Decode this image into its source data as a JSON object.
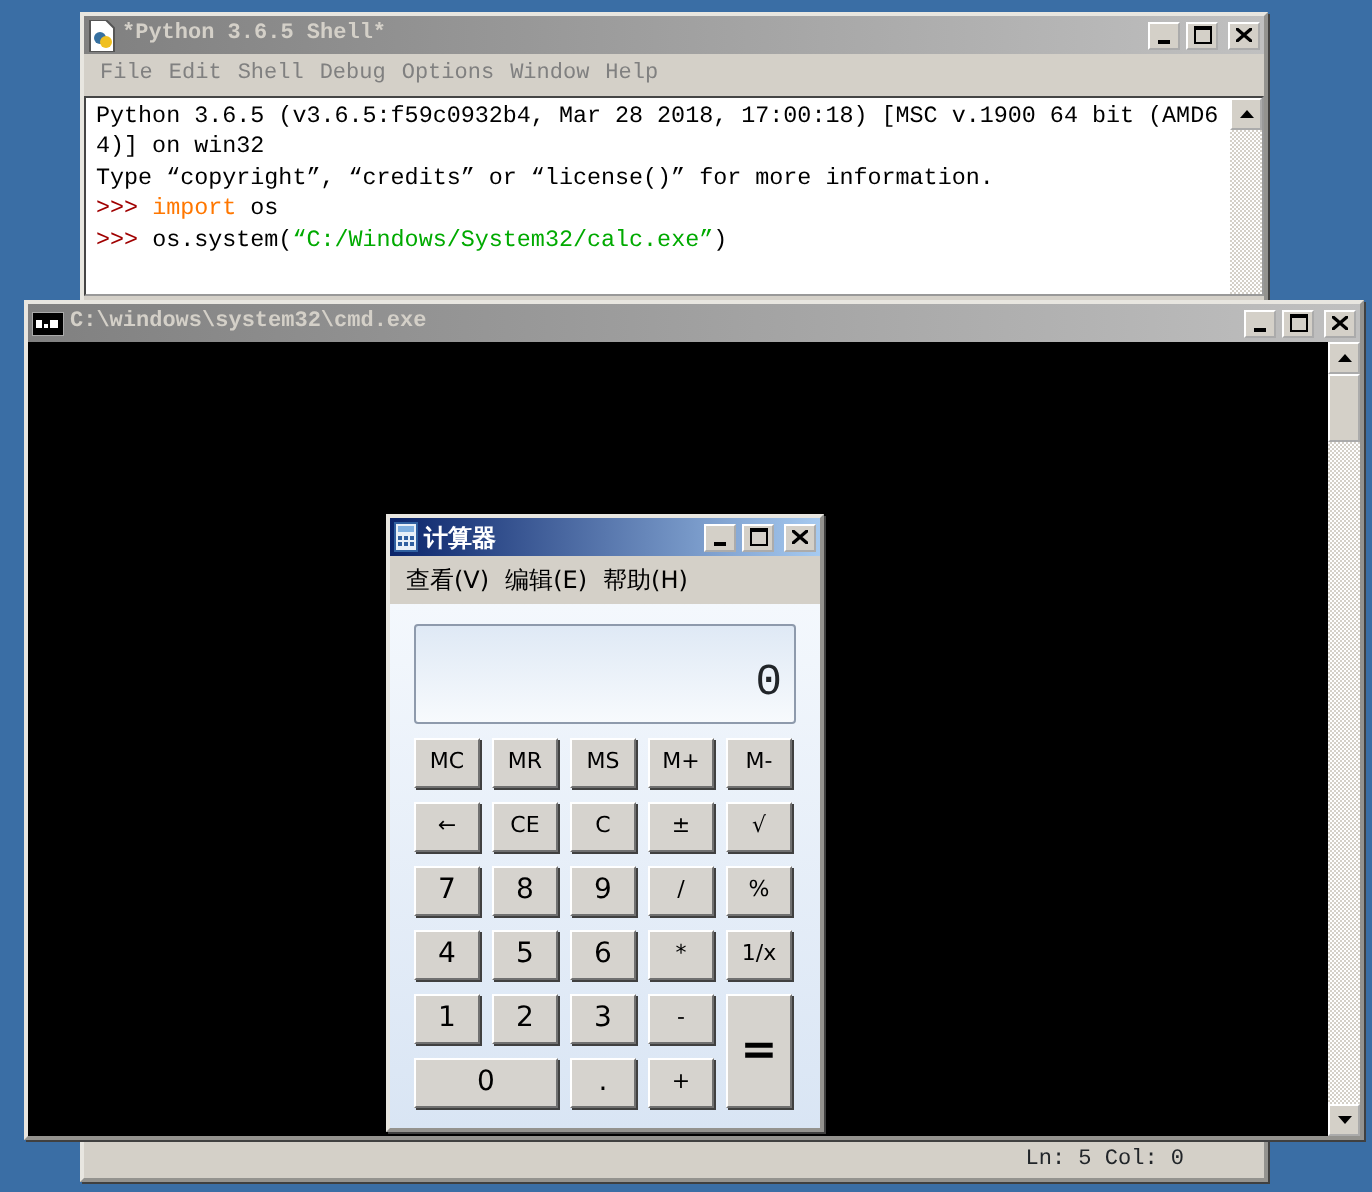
{
  "idle": {
    "title": "*Python 3.6.5 Shell*",
    "menu": [
      "File",
      "Edit",
      "Shell",
      "Debug",
      "Options",
      "Window",
      "Help"
    ],
    "lines": [
      [
        {
          "kind": "text",
          "text": "Python 3.6.5 (v3.6.5:f59c0932b4, Mar 28 2018, 17:00:18) [MSC v.1900 64 bit (AMD6"
        }
      ],
      [
        {
          "kind": "text",
          "text": "4)] on win32"
        }
      ],
      [
        {
          "kind": "text",
          "text": "Type “copyright”, “credits” or “license()” for more information."
        }
      ],
      [
        {
          "kind": "prompt",
          "text": ">>> "
        },
        {
          "kind": "keyword",
          "text": "import"
        },
        {
          "kind": "text",
          "text": " os"
        }
      ],
      [
        {
          "kind": "prompt",
          "text": ">>> "
        },
        {
          "kind": "text",
          "text": "os.system("
        },
        {
          "kind": "string",
          "text": "“C:/Windows/System32/calc.exe”"
        },
        {
          "kind": "text",
          "text": ")"
        }
      ]
    ],
    "status": "Ln: 5  Col: 0"
  },
  "cmd": {
    "title": "C:\\windows\\system32\\cmd.exe"
  },
  "calc": {
    "title": "计算器",
    "menu": [
      "查看(V)",
      "编辑(E)",
      "帮助(H)"
    ],
    "display": "0",
    "buttons": [
      {
        "label": "MC",
        "kind": "normal"
      },
      {
        "label": "MR",
        "kind": "normal"
      },
      {
        "label": "MS",
        "kind": "normal"
      },
      {
        "label": "M+",
        "kind": "normal"
      },
      {
        "label": "M-",
        "kind": "normal"
      },
      {
        "label": "←",
        "kind": "normal"
      },
      {
        "label": "CE",
        "kind": "normal"
      },
      {
        "label": "C",
        "kind": "normal"
      },
      {
        "label": "±",
        "kind": "normal"
      },
      {
        "label": "√",
        "kind": "normal"
      },
      {
        "label": "7",
        "kind": "normal"
      },
      {
        "label": "8",
        "kind": "normal"
      },
      {
        "label": "9",
        "kind": "normal"
      },
      {
        "label": "/",
        "kind": "normal"
      },
      {
        "label": "%",
        "kind": "normal"
      },
      {
        "label": "4",
        "kind": "normal"
      },
      {
        "label": "5",
        "kind": "normal"
      },
      {
        "label": "6",
        "kind": "normal"
      },
      {
        "label": "*",
        "kind": "normal"
      },
      {
        "label": "1/x",
        "kind": "normal"
      },
      {
        "label": "1",
        "kind": "normal"
      },
      {
        "label": "2",
        "kind": "normal"
      },
      {
        "label": "3",
        "kind": "normal"
      },
      {
        "label": "-",
        "kind": "normal"
      },
      {
        "label": "=",
        "kind": "tall"
      },
      {
        "label": "0",
        "kind": "wide"
      },
      {
        "label": ".",
        "kind": "normal"
      },
      {
        "label": "+",
        "kind": "normal"
      }
    ]
  }
}
